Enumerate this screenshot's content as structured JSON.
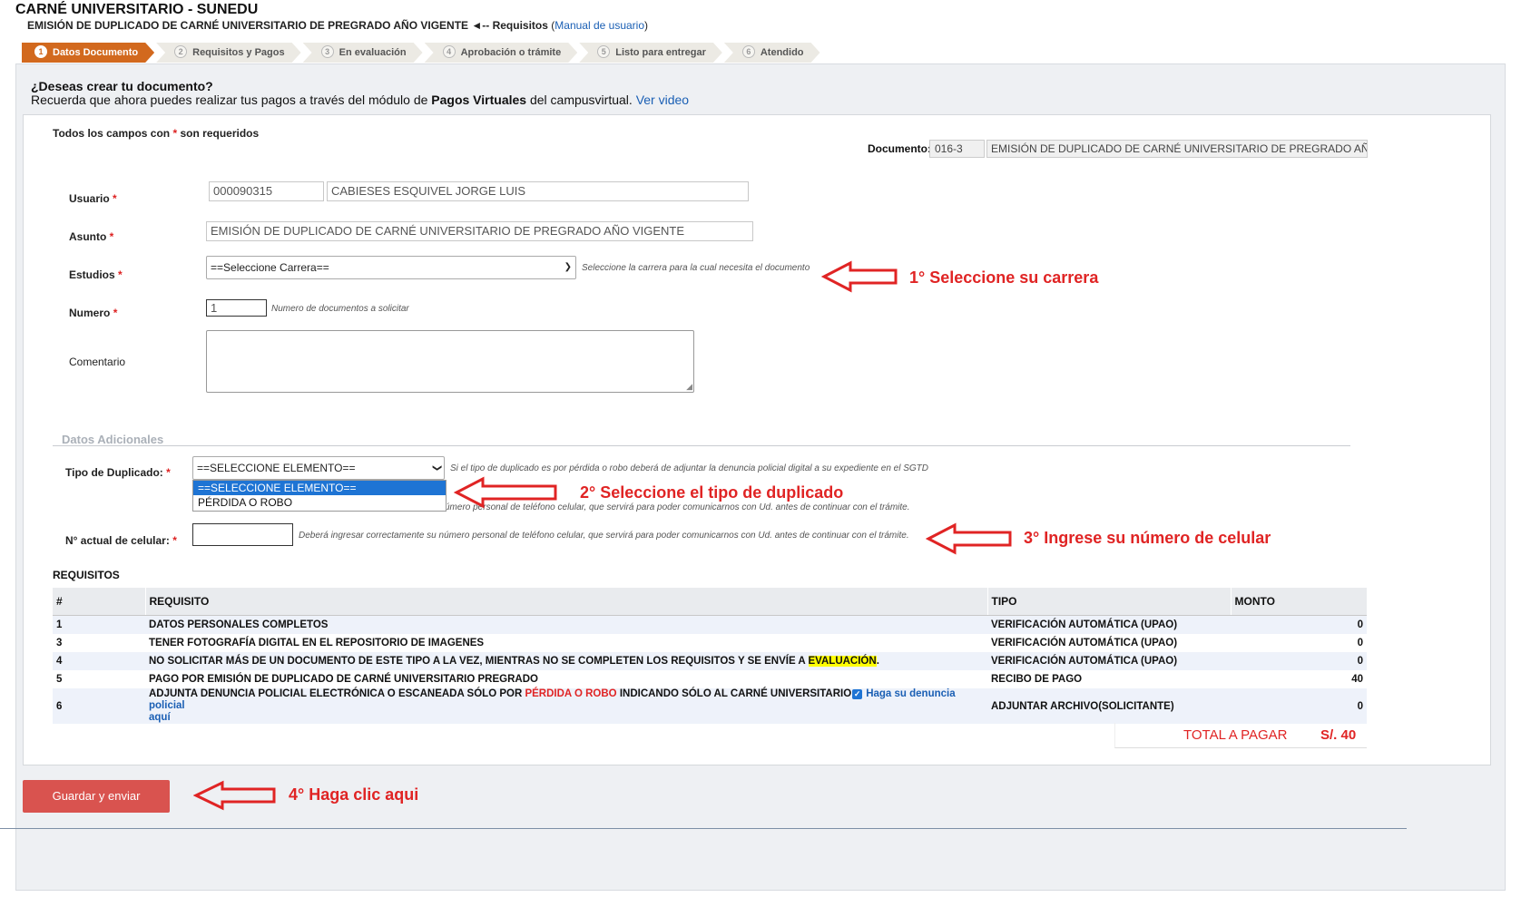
{
  "header": {
    "title": "CARNÉ UNIVERSITARIO - SUNEDU",
    "subtitle": "EMISIÓN DE DUPLICADO DE CARNÉ UNIVERSITARIO DE PREGRADO AÑO VIGENTE",
    "requisitos_link": "◄-- Requisitos",
    "manual_prefix": "(",
    "manual_link": "Manual de usuario",
    "manual_suffix": ")"
  },
  "steps": [
    {
      "num": "1",
      "label": "Datos Documento"
    },
    {
      "num": "2",
      "label": "Requisitos y Pagos"
    },
    {
      "num": "3",
      "label": "En evaluación"
    },
    {
      "num": "4",
      "label": "Aprobación o trámite"
    },
    {
      "num": "5",
      "label": "Listo para entregar"
    },
    {
      "num": "6",
      "label": "Atendido"
    }
  ],
  "intro": {
    "question": "¿Deseas crear tu documento?",
    "text_before": "Recuerda que ahora puedes realizar tus pagos a través del módulo de ",
    "text_bold": "Pagos Virtuales",
    "text_after": " del campusvirtual. ",
    "video_link": "Ver video"
  },
  "form": {
    "required_note": "Todos los campos con",
    "required_star": "*",
    "required_note_end": "son requeridos",
    "documento_label": "Documento:",
    "documento_code": "016-3",
    "documento_name": "EMISIÓN DE DUPLICADO DE CARNÉ UNIVERSITARIO DE PREGRADO AÑO VI",
    "usuario_label": "Usuario",
    "usuario_code": "000090315",
    "usuario_name": "CABIESES  ESQUIVEL JORGE LUIS",
    "asunto_label": "Asunto",
    "asunto_value": "EMISIÓN DE DUPLICADO DE CARNÉ UNIVERSITARIO DE PREGRADO AÑO VIGENTE",
    "estudios_label": "Estudios",
    "estudios_value": "==Seleccione Carrera==",
    "estudios_help": "Seleccione la carrera para la cual necesita el documento",
    "numero_label": "Numero",
    "numero_value": "1",
    "numero_help": "Numero de documentos a solicitar",
    "comentario_label": "Comentario"
  },
  "additional": {
    "section_title": "Datos Adicionales",
    "tipo_label": "Tipo de Duplicado:",
    "tipo_value": "==SELECCIONE ELEMENTO==",
    "tipo_help": "Si el tipo de duplicado es por pérdida o robo deberá de adjuntar la denuncia policial digital a su expediente en el SGTD",
    "tipo_options": [
      "==SELECCIONE ELEMENTO==",
      "PÉRDIDA O ROBO"
    ],
    "hidden_help_partial": "úmero personal de teléfono celular, que servirá para poder comunicarnos con Ud. antes de continuar con el trámite.",
    "celular_label": "N° actual de celular:",
    "celular_value": "",
    "celular_help": "Deberá ingresar correctamente su número personal de teléfono celular, que servirá para poder comunicarnos con Ud. antes de continuar con el trámite."
  },
  "annotations": {
    "a1": "1° Seleccione su carrera",
    "a2": "2° Seleccione el tipo de duplicado",
    "a3": "3° Ingrese su número de celular",
    "a4": "4° Haga clic aqui"
  },
  "requisitos": {
    "title": "REQUISITOS",
    "headers": [
      "#",
      "REQUISITO",
      "TIPO",
      "MONTO"
    ],
    "rows": [
      {
        "n": "1",
        "req": "DATOS PERSONALES COMPLETOS",
        "tipo": "VERIFICACIÓN AUTOMÁTICA (UPAO)",
        "monto": "0"
      },
      {
        "n": "3",
        "req": "TENER FOTOGRAFÍA DIGITAL EN EL REPOSITORIO DE IMAGENES",
        "tipo": "VERIFICACIÓN AUTOMÁTICA (UPAO)",
        "monto": "0"
      },
      {
        "n": "4",
        "req_pre": "NO SOLICITAR MÁS DE UN DOCUMENTO DE ESTE TIPO A LA VEZ,  MIENTRAS NO SE COMPLETEN LOS REQUISITOS Y SE ENVÍE A ",
        "req_hl": "EVALUACIÓN",
        "req_post": ".",
        "tipo": "VERIFICACIÓN AUTOMÁTICA (UPAO)",
        "monto": "0"
      },
      {
        "n": "5",
        "req": "PAGO POR EMISIÓN DE DUPLICADO DE CARNÉ UNIVERSITARIO PREGRADO",
        "tipo": "RECIBO DE PAGO",
        "monto": "40"
      },
      {
        "n": "6",
        "req_pre": "ADJUNTA DENUNCIA POLICIAL ELECTRÓNICA O ESCANEADA SÓLO POR ",
        "req_red": "PÉRDIDA O ROBO",
        "req_post": " INDICANDO SÓLO AL CARNÉ UNIVERSITARIO",
        "req_link": "Haga su denuncia policial",
        "req_link2": "aquí",
        "tipo": "ADJUNTAR ARCHIVO(SOLICITANTE)",
        "monto": "0"
      }
    ],
    "total_label": "TOTAL A PAGAR",
    "total_value": "S/. 40"
  },
  "actions": {
    "save_label": "Guardar y enviar"
  },
  "colors": {
    "accent": "#d2691e",
    "button": "#d9534f",
    "annotation": "#e02424",
    "link": "#1a5fb4"
  }
}
